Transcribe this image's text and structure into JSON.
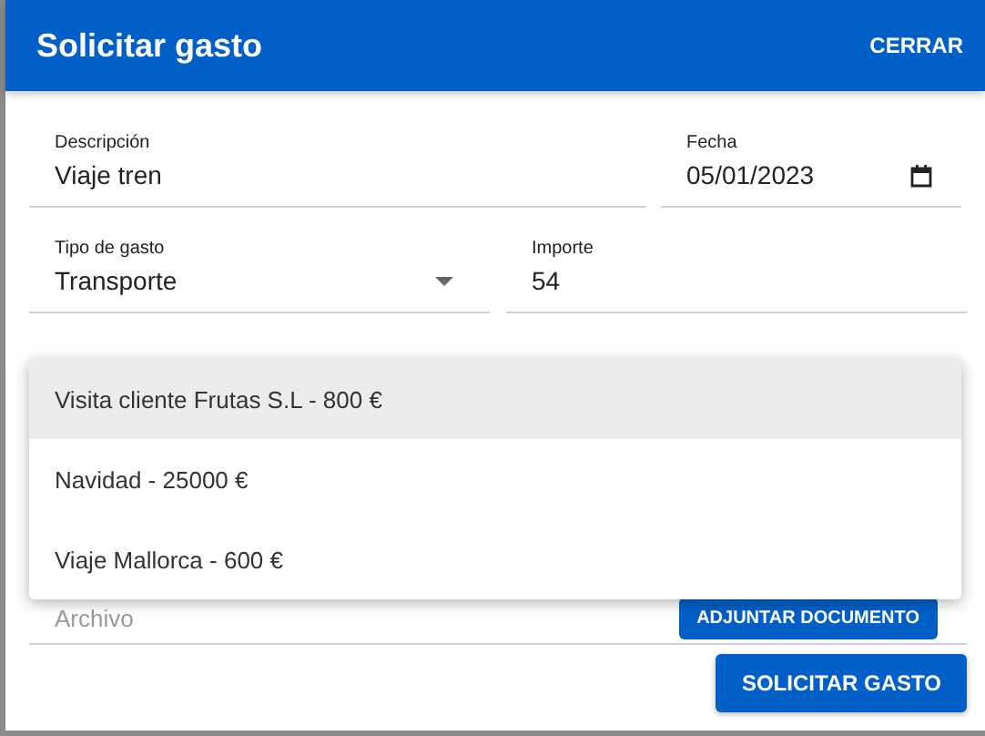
{
  "dialog": {
    "title": "Solicitar gasto",
    "close_button": "CERRAR"
  },
  "fields": [
    {
      "label": "Descripción",
      "value": "Viaje tren",
      "kind": "text"
    },
    {
      "label": "Fecha",
      "value": "05/01/2023",
      "kind": "date"
    },
    {
      "label": "Tipo de gasto",
      "value": "Transporte",
      "kind": "select"
    },
    {
      "label": "Importe",
      "value": "54",
      "kind": "text"
    }
  ],
  "attachment": {
    "label": "Archivo",
    "button": "ADJUNTAR DOCUMENTO"
  },
  "menu": {
    "options": [
      {
        "label": "Visita cliente Frutas S.L - 800 €",
        "selected": true
      },
      {
        "label": "Navidad - 25000 €",
        "selected": false
      },
      {
        "label": "Viaje Mallorca - 600 €",
        "selected": false
      }
    ]
  },
  "submit_button": "SOLICITAR GASTO"
}
